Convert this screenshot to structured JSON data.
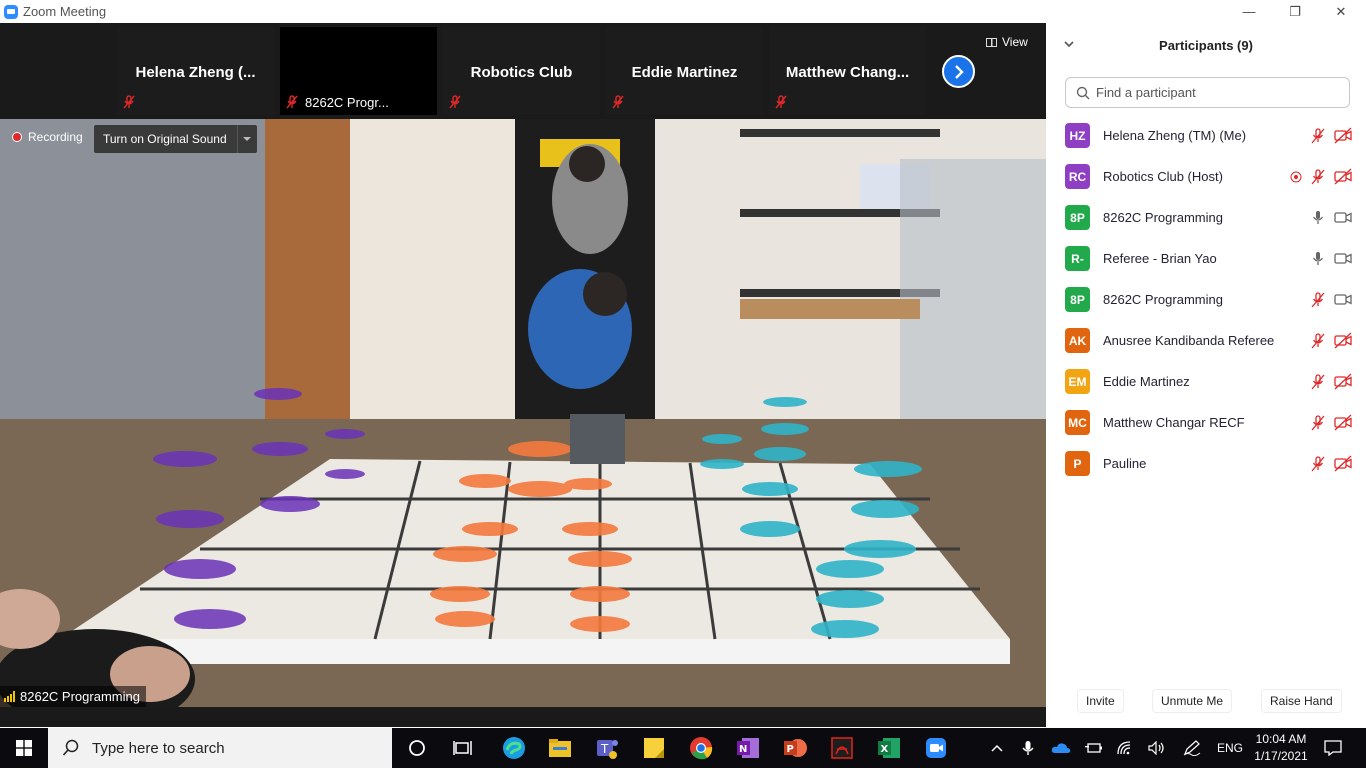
{
  "window": {
    "title": "Zoom Meeting",
    "minimize": "—",
    "maximize": "❐",
    "close": "✕"
  },
  "strip": {
    "tiles": [
      {
        "name": "Helena  Zheng  (..."
      },
      {
        "caption": "8262C  Progr..."
      },
      {
        "name": "Robotics Club"
      },
      {
        "name": "Eddie Martinez"
      },
      {
        "name": "Matthew  Chang..."
      }
    ],
    "view_label": "View"
  },
  "video": {
    "recording_label": "Recording",
    "original_sound_label": "Turn on Original Sound",
    "speaker_name": "8262C Programming"
  },
  "participants": {
    "title": "Participants (9)",
    "search_placeholder": "Find a participant",
    "list": [
      {
        "initials": "HZ",
        "name": "Helena Zheng (TM) (Me)",
        "color": "#8e3fc4",
        "mic": "muted",
        "video": "off",
        "recording": false
      },
      {
        "initials": "RC",
        "name": "Robotics Club (Host)",
        "color": "#8e3fc4",
        "mic": "muted",
        "video": "off",
        "recording": true
      },
      {
        "initials": "8P",
        "name": "8262C Programming",
        "color": "#22a94b",
        "mic": "on",
        "video": "on",
        "recording": false
      },
      {
        "initials": "R-",
        "name": "Referee - Brian Yao",
        "color": "#22a94b",
        "mic": "on",
        "video": "on",
        "recording": false
      },
      {
        "initials": "8P",
        "name": "8262C Programming",
        "color": "#22a94b",
        "mic": "muted",
        "video": "on",
        "recording": false
      },
      {
        "initials": "AK",
        "name": "Anusree Kandibanda Referee",
        "color": "#e0650e",
        "mic": "muted",
        "video": "off",
        "recording": false
      },
      {
        "initials": "EM",
        "name": "Eddie Martinez",
        "color": "#f2a413",
        "mic": "muted",
        "video": "off",
        "recording": false
      },
      {
        "initials": "MC",
        "name": "Matthew Changar RECF",
        "color": "#e0650e",
        "mic": "muted",
        "video": "off",
        "recording": false
      },
      {
        "initials": "P",
        "name": "Pauline",
        "color": "#e0650e",
        "mic": "muted",
        "video": "off",
        "recording": false
      }
    ],
    "footer": {
      "invite": "Invite",
      "unmute": "Unmute Me",
      "raise_hand": "Raise Hand"
    }
  },
  "taskbar": {
    "search_placeholder": "Type here to search",
    "language": "ENG",
    "time": "10:04 AM",
    "date": "1/17/2021"
  }
}
